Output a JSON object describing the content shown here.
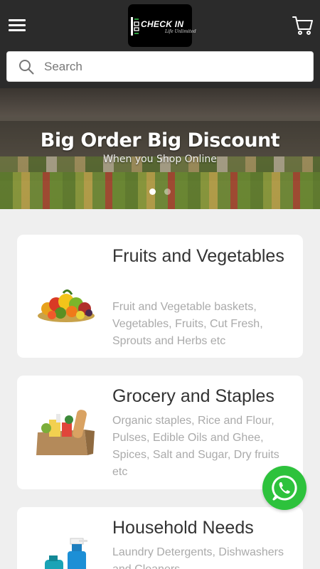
{
  "header": {
    "logo_text": "CHECK IN",
    "logo_tagline": "Life Unlimited",
    "menu_icon": "hamburger-menu-icon",
    "cart_icon": "shopping-cart-icon"
  },
  "search": {
    "placeholder": "Search",
    "value": "",
    "icon": "search-icon"
  },
  "banner": {
    "headline": "Big Order Big Discount",
    "subline": "When you Shop Online",
    "slides_total": 2,
    "active_slide": 1
  },
  "categories": [
    {
      "title": "Fruits and Vegetables",
      "description": "Fruit and Vegetable baskets, Vegetables, Fruits, Cut Fresh, Sprouts and Herbs etc",
      "image": "fruit-basket-image"
    },
    {
      "title": "Grocery and Staples",
      "description": "Organic staples, Rice and Flour, Pulses, Edible Oils and Ghee, Spices, Salt and Sugar, Dry fruits etc",
      "image": "grocery-bag-image"
    },
    {
      "title": "Household Needs",
      "description": "Laundry Detergents, Dishwashers and Cleaners",
      "image": "cleaning-bottles-image"
    }
  ],
  "floating": {
    "whatsapp_icon": "whatsapp-icon"
  },
  "colors": {
    "header_bg": "#2b2b2b",
    "page_bg": "#efefef",
    "whatsapp_green": "#2dc23c",
    "title_text": "#333333",
    "desc_text": "#aaaaaa"
  }
}
